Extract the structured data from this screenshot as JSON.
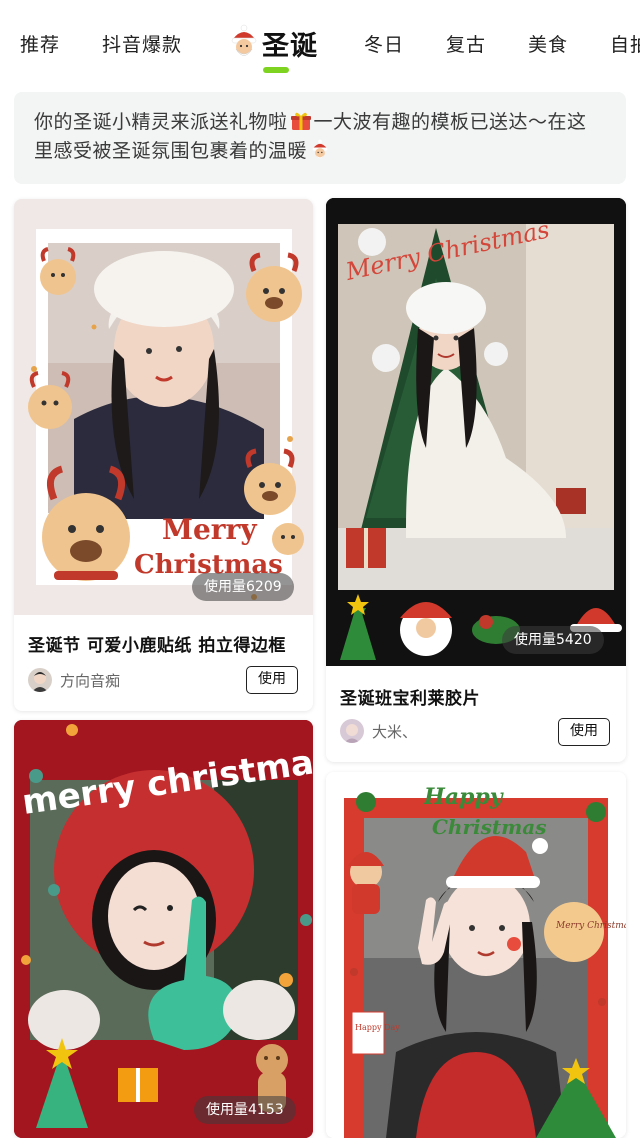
{
  "tabs": {
    "items": [
      "推荐",
      "抖音爆款",
      "圣诞",
      "冬日",
      "复古",
      "美食",
      "自拍"
    ],
    "active_index": 2,
    "active_icon": "santa-face-icon",
    "accent": "#7ed321"
  },
  "banner": {
    "text_1": "你的圣诞小精灵来派送礼物啦",
    "icon_1": "gift-icon",
    "text_2": "一大波有趣的模板已送达～在这里感受被圣诞氛围包裹着的温暖",
    "icon_2": "santa-face-icon"
  },
  "cards": [
    {
      "usage": "使用量6209",
      "title": "圣诞节 可爱小鹿贴纸 拍立得边框",
      "author": "方向音痴",
      "button": "使用",
      "frame_text_1": "Merry",
      "frame_text_2": "Christmas"
    },
    {
      "usage": "使用量5420",
      "title": "圣诞班宝利莱胶片",
      "author": "大米、",
      "button": "使用",
      "frame_text_1": "Merry Christmas"
    },
    {
      "usage": "使用量4153",
      "frame_text_1": "merry christmas"
    },
    {
      "frame_text_1": "Happy",
      "frame_text_2": "Christmas",
      "frame_text_3": "Merry Christmas",
      "frame_text_4": "Happy Day"
    }
  ]
}
